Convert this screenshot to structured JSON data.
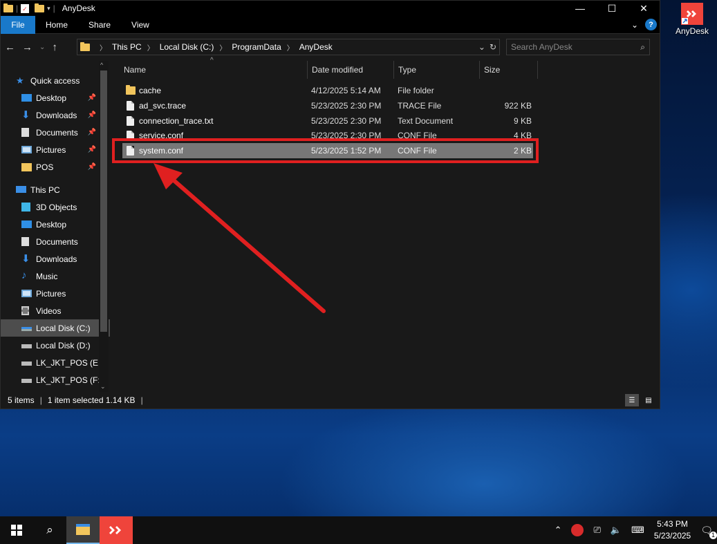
{
  "window": {
    "title": "AnyDesk",
    "controls": {
      "minimize": "—",
      "maximize": "☐",
      "close": "✕"
    }
  },
  "ribbon": {
    "tabs": [
      "File",
      "Home",
      "Share",
      "View"
    ],
    "help": "?"
  },
  "address": {
    "crumbs": [
      "This PC",
      "Local Disk (C:)",
      "ProgramData",
      "AnyDesk"
    ],
    "search_placeholder": "Search AnyDesk"
  },
  "sidebar": {
    "quick_access_label": "Quick access",
    "quick_access": [
      {
        "label": "Desktop",
        "icon": "desktop-icon",
        "pinned": true
      },
      {
        "label": "Downloads",
        "icon": "downloads-icon",
        "pinned": true
      },
      {
        "label": "Documents",
        "icon": "documents-icon",
        "pinned": true
      },
      {
        "label": "Pictures",
        "icon": "pictures-icon",
        "pinned": true
      },
      {
        "label": "POS",
        "icon": "folder-icon",
        "pinned": true
      }
    ],
    "this_pc_label": "This PC",
    "this_pc": [
      {
        "label": "3D Objects",
        "icon": "3d-objects-icon"
      },
      {
        "label": "Desktop",
        "icon": "desktop-icon"
      },
      {
        "label": "Documents",
        "icon": "documents-icon"
      },
      {
        "label": "Downloads",
        "icon": "downloads-icon"
      },
      {
        "label": "Music",
        "icon": "music-icon"
      },
      {
        "label": "Pictures",
        "icon": "pictures-icon"
      },
      {
        "label": "Videos",
        "icon": "videos-icon"
      },
      {
        "label": "Local Disk (C:)",
        "icon": "drive-icon",
        "selected": true
      },
      {
        "label": "Local Disk (D:)",
        "icon": "drive-icon"
      },
      {
        "label": "LK_JKT_POS (E:)",
        "icon": "drive-icon"
      },
      {
        "label": "LK_JKT_POS (F:)",
        "icon": "drive-icon"
      }
    ]
  },
  "columns": {
    "name": "Name",
    "date": "Date modified",
    "type": "Type",
    "size": "Size"
  },
  "files": [
    {
      "name": "cache",
      "date": "4/12/2025 5:14 AM",
      "type": "File folder",
      "size": "",
      "icon": "folder-icon"
    },
    {
      "name": "ad_svc.trace",
      "date": "5/23/2025 2:30 PM",
      "type": "TRACE File",
      "size": "922 KB",
      "icon": "file-icon"
    },
    {
      "name": "connection_trace.txt",
      "date": "5/23/2025 2:30 PM",
      "type": "Text Document",
      "size": "9 KB",
      "icon": "file-icon"
    },
    {
      "name": "service.conf",
      "date": "5/23/2025 2:30 PM",
      "type": "CONF File",
      "size": "4 KB",
      "icon": "file-icon"
    },
    {
      "name": "system.conf",
      "date": "5/23/2025 1:52 PM",
      "type": "CONF File",
      "size": "2 KB",
      "icon": "file-icon",
      "selected": true
    }
  ],
  "status": {
    "items": "5 items",
    "selected": "1 item selected  1.14 KB"
  },
  "desktop": {
    "icon_label": "AnyDesk"
  },
  "taskbar": {
    "time": "5:43 PM",
    "date": "5/23/2025",
    "notification_count": "1"
  },
  "colors": {
    "accent": "#1979ca",
    "annotation": "#e02020",
    "anydesk": "#ef443b"
  }
}
